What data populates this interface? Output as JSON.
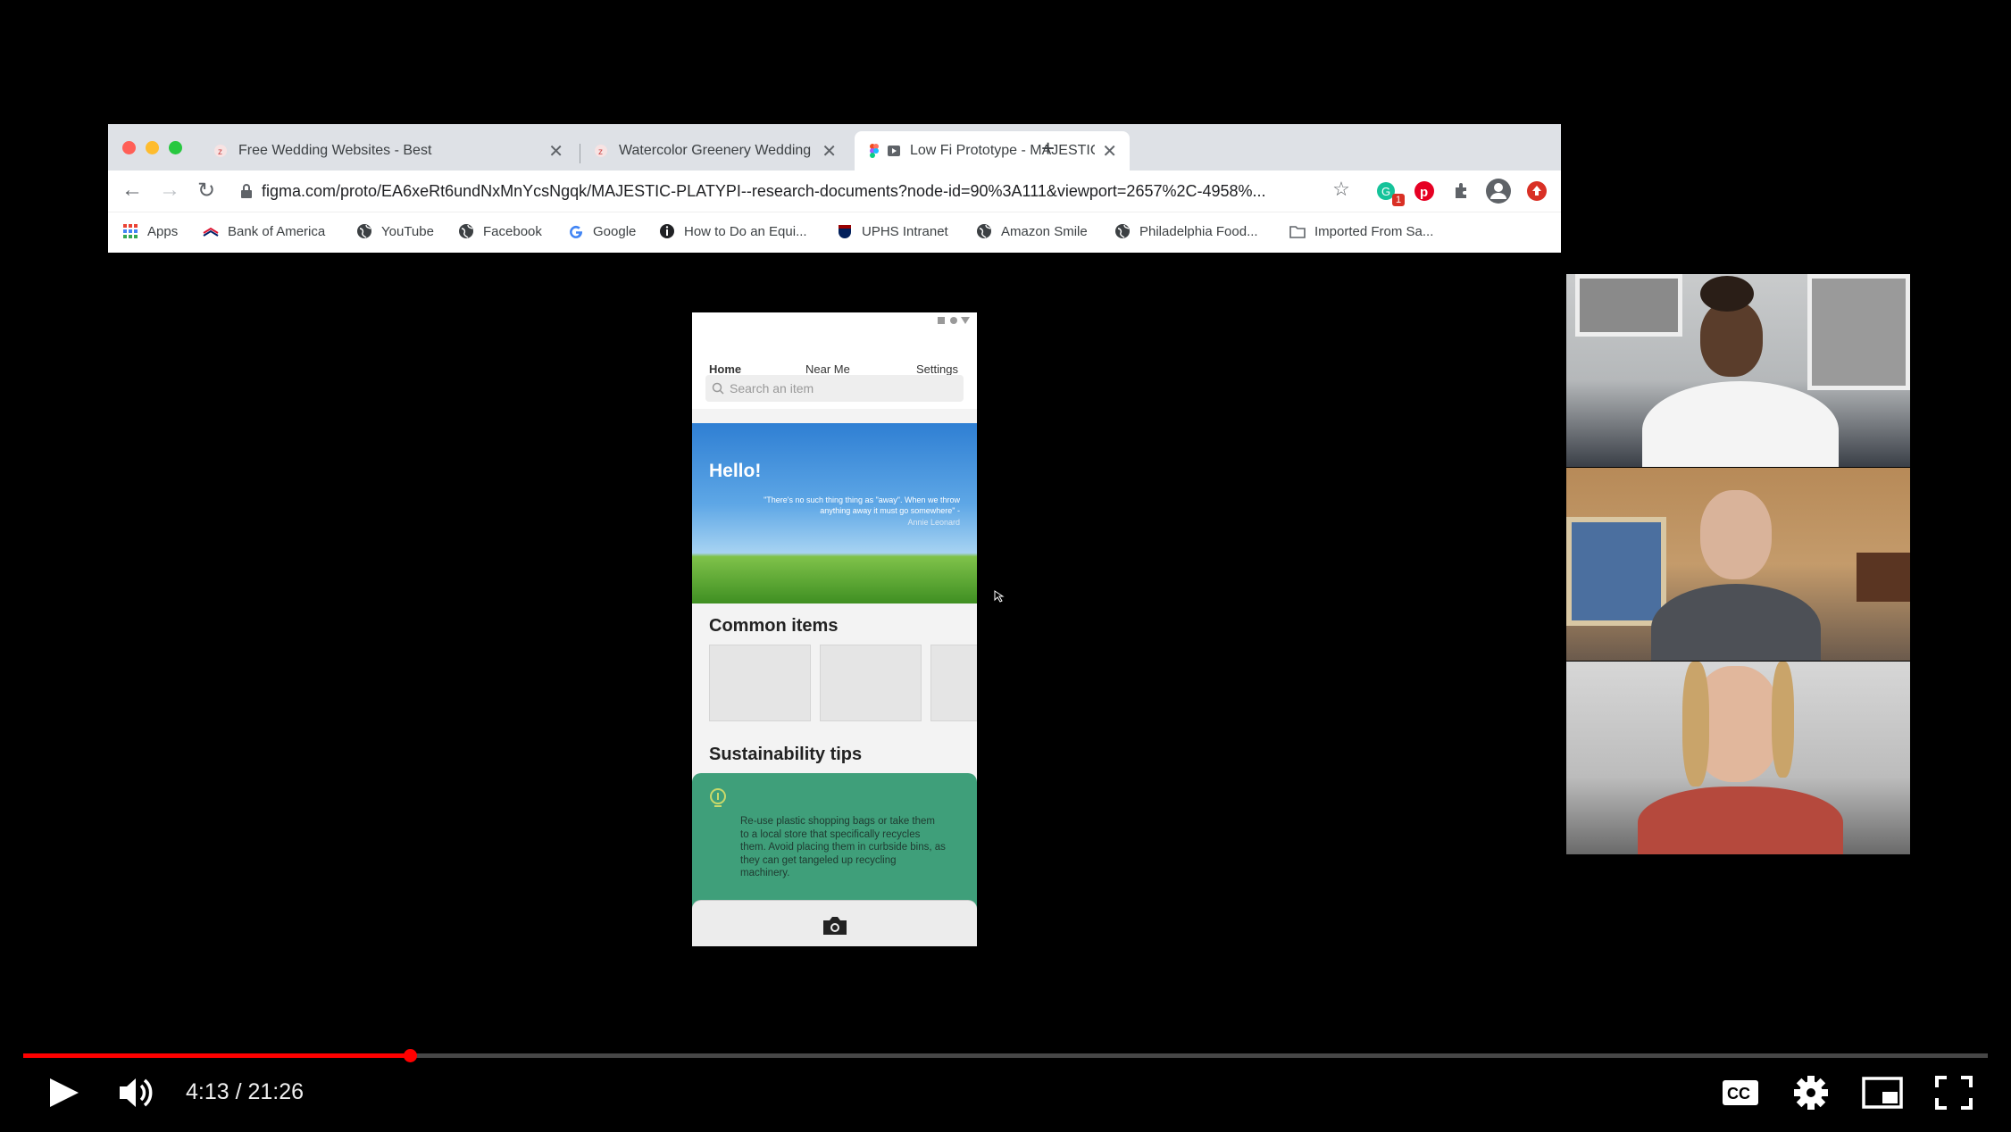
{
  "browser": {
    "tabs": [
      {
        "title": "Free Wedding Websites - Best",
        "active": false
      },
      {
        "title": "Watercolor Greenery Wedding",
        "active": false
      },
      {
        "title": "Low Fi Prototype - MAJESTIC",
        "active": true
      }
    ],
    "url": "figma.com/proto/EA6xeRt6undNxMnYcsNgqk/MAJESTIC-PLATYPI--research-documents?node-id=90%3A111&viewport=2657%2C-4958%...",
    "extension_badge": "1",
    "bookmarks": [
      {
        "label": "Apps",
        "icon": "apps-grid-icon"
      },
      {
        "label": "Bank of America",
        "icon": "bank-of-america-icon"
      },
      {
        "label": "YouTube",
        "icon": "globe-icon"
      },
      {
        "label": "Facebook",
        "icon": "globe-icon"
      },
      {
        "label": "Google",
        "icon": "google-icon"
      },
      {
        "label": "How to Do an Equi...",
        "icon": "info-icon"
      },
      {
        "label": "UPHS Intranet",
        "icon": "penn-icon"
      },
      {
        "label": "Amazon Smile",
        "icon": "globe-icon"
      },
      {
        "label": "Philadelphia Food...",
        "icon": "globe-icon"
      },
      {
        "label": "Imported From Sa...",
        "icon": "folder-icon"
      }
    ]
  },
  "prototype": {
    "nav": {
      "home": "Home",
      "near_me": "Near Me",
      "settings": "Settings"
    },
    "search_placeholder": "Search an item",
    "hero": {
      "greeting": "Hello!",
      "quote": "\"There's no such thing thing as \"away\". When we throw anything away it must go somewhere\" -",
      "author": "Annie Leonard"
    },
    "common_items_heading": "Common items",
    "tips_heading": "Sustainability tips",
    "tip_text": "Re-use plastic shopping bags or take them to a local store that specifically recycles them. Avoid placing them in curbside bins, as they can get tangeled up recycling machinery."
  },
  "player": {
    "time": "4:13 / 21:26",
    "progress": 0.197,
    "accent_color": "#ff0000"
  }
}
